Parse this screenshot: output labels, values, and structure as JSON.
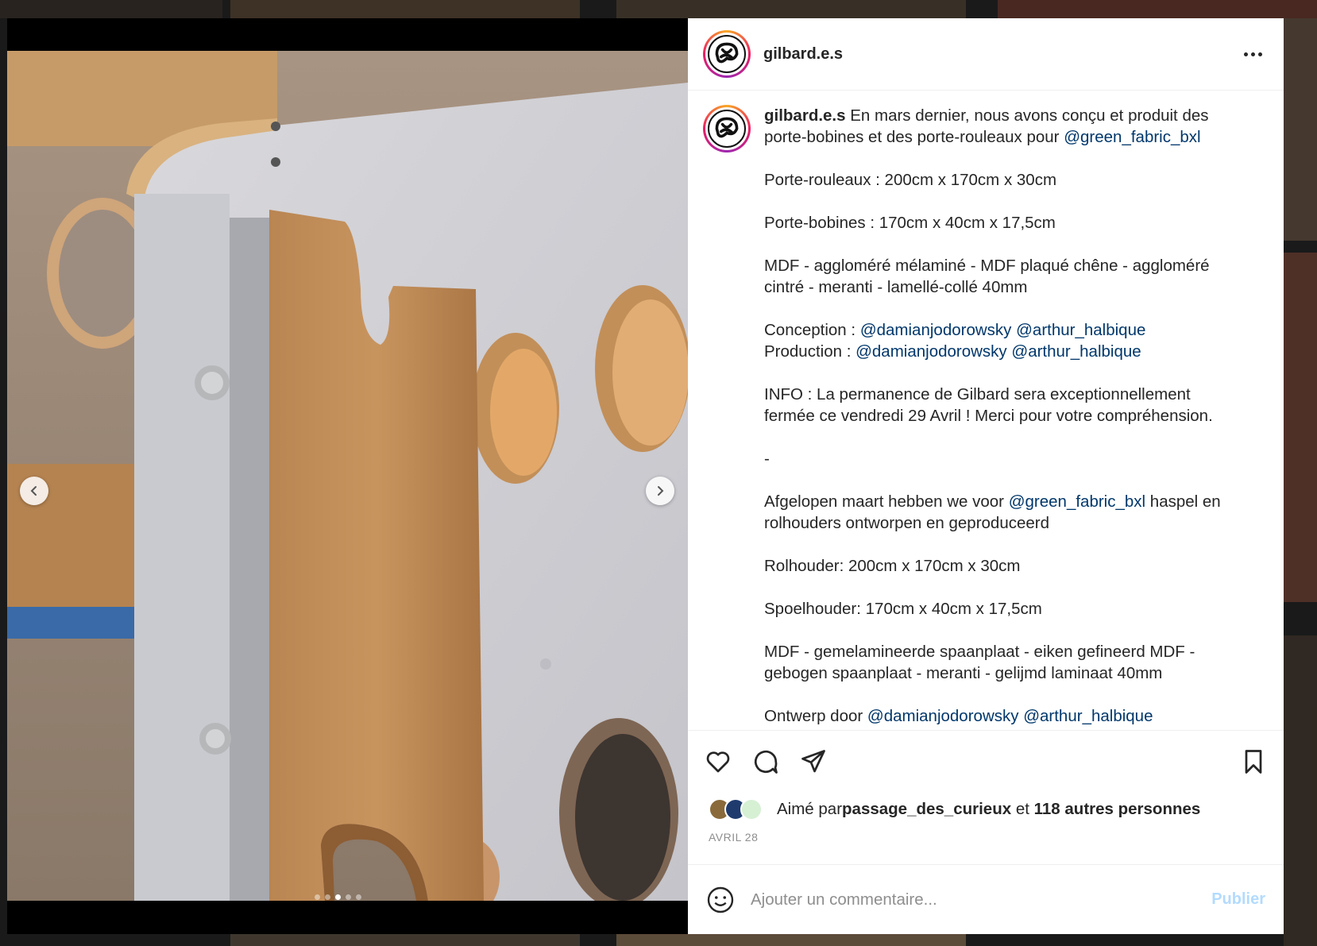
{
  "post": {
    "username": "gilbard.e.s",
    "caption_username": "gilbard.e.s",
    "caption_lines": [
      {
        "parts": [
          {
            "t": "En mars dernier, nous avons conçu et produit des porte-bobines et des porte-rouleaux pour "
          },
          {
            "t": "@green_fabric_bxl",
            "m": true
          }
        ]
      },
      {
        "gap": true
      },
      {
        "parts": [
          {
            "t": "Porte-rouleaux : 200cm x 170cm x 30cm"
          }
        ]
      },
      {
        "gap": true
      },
      {
        "parts": [
          {
            "t": "Porte-bobines : 170cm x 40cm x 17,5cm"
          }
        ]
      },
      {
        "gap": true
      },
      {
        "parts": [
          {
            "t": "MDF - aggloméré mélaminé - MDF plaqué chêne - aggloméré cintré - meranti - lamellé-collé 40mm"
          }
        ]
      },
      {
        "gap": true
      },
      {
        "parts": [
          {
            "t": "Conception : "
          },
          {
            "t": "@damianjodorowsky",
            "m": true
          },
          {
            "t": " "
          },
          {
            "t": "@arthur_halbique",
            "m": true
          }
        ]
      },
      {
        "parts": [
          {
            "t": "Production : "
          },
          {
            "t": "@damianjodorowsky",
            "m": true
          },
          {
            "t": " "
          },
          {
            "t": "@arthur_halbique",
            "m": true
          }
        ]
      },
      {
        "gap": true
      },
      {
        "parts": [
          {
            "t": "INFO : La permanence de Gilbard sera exceptionnellement fermée ce vendredi 29 Avril ! Merci pour votre compréhension."
          }
        ]
      },
      {
        "gap": true
      },
      {
        "parts": [
          {
            "t": "-"
          }
        ]
      },
      {
        "gap": true
      },
      {
        "parts": [
          {
            "t": "Afgelopen maart hebben we voor "
          },
          {
            "t": "@green_fabric_bxl",
            "m": true
          },
          {
            "t": " haspel en rolhouders ontworpen en geproduceerd"
          }
        ]
      },
      {
        "gap": true
      },
      {
        "parts": [
          {
            "t": "Rolhouder: 200cm x 170cm x 30cm"
          }
        ]
      },
      {
        "gap": true
      },
      {
        "parts": [
          {
            "t": "Spoelhouder: 170cm x 40cm x 17,5cm"
          }
        ]
      },
      {
        "gap": true
      },
      {
        "parts": [
          {
            "t": "MDF - gemelamineerde spaanplaat - eiken gefineerd MDF - gebogen spaanplaat - meranti - gelijmd laminaat 40mm"
          }
        ]
      },
      {
        "gap": true
      },
      {
        "parts": [
          {
            "t": "Ontwerp door "
          },
          {
            "t": "@damianjodorowsky",
            "m": true
          },
          {
            "t": " "
          },
          {
            "t": "@arthur_halbique",
            "m": true
          }
        ]
      }
    ],
    "likes": {
      "prefix": "Aimé par ",
      "user": "passage_des_curieux",
      "middle": " et ",
      "others": "118 autres personnes"
    },
    "date": "AVRIL 28",
    "carousel": {
      "count": 5,
      "active_index": 2
    }
  },
  "comment": {
    "placeholder": "Ajouter un commentaire...",
    "publish_label": "Publier"
  },
  "icons": {
    "like": "heart-icon",
    "comment": "comment-icon",
    "share": "send-icon",
    "save": "bookmark-icon",
    "emoji": "emoji-icon",
    "more": "more-options-icon"
  },
  "colors": {
    "mention": "#00376b",
    "publish_disabled": "#b3dbff",
    "muted": "#8e8e8e"
  }
}
